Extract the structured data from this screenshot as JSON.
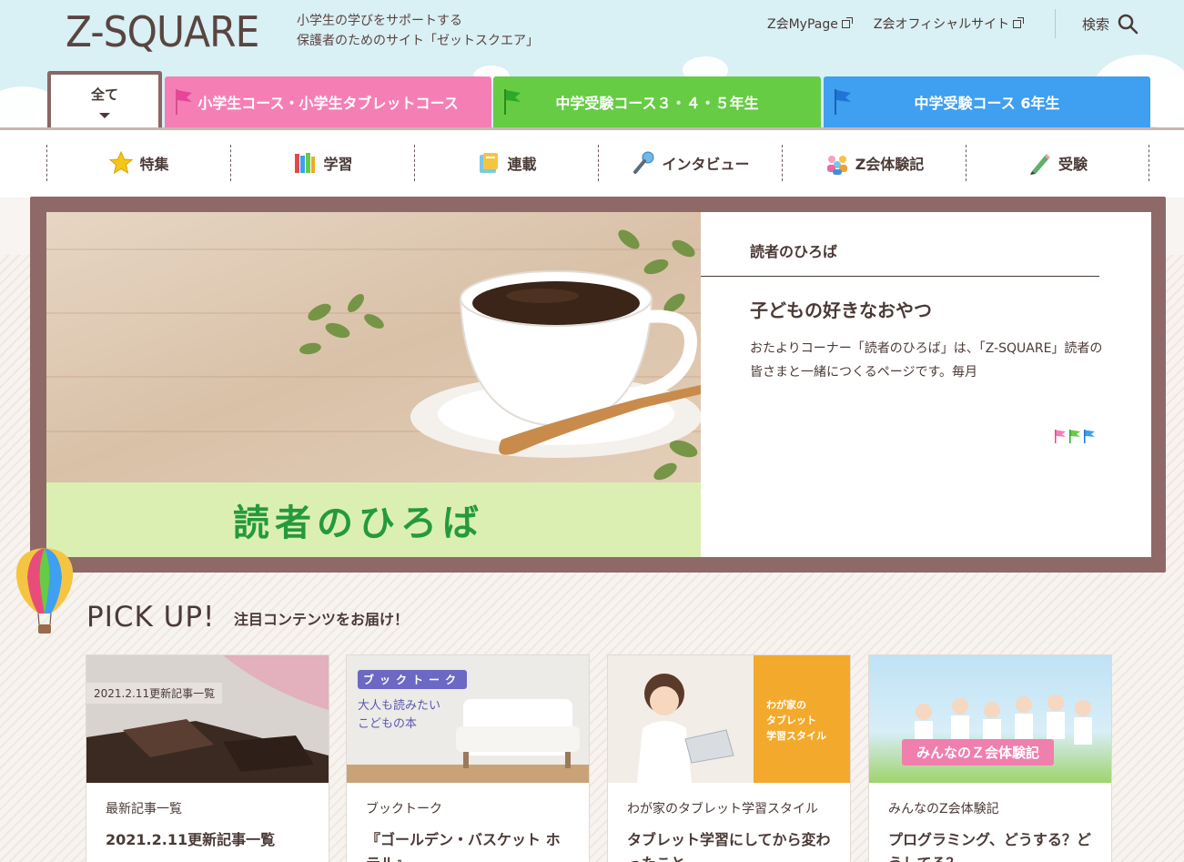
{
  "header": {
    "logo": "Z-SQUARE",
    "tagline_line1": "小学生の学びをサポートする",
    "tagline_line2": "保護者のためのサイト「ゼットスクエア」",
    "links": [
      {
        "label": "Z会MyPage"
      },
      {
        "label": "Z会オフィシャルサイト"
      }
    ],
    "search_label": "検索"
  },
  "tabs": {
    "all": "全て",
    "elementary": "小学生コース・小学生タブレットコース",
    "exam345": "中学受験コース３・４・５年生",
    "exam6": "中学受験コース 6年生",
    "colors": {
      "pink": "#f57fb5",
      "green": "#66cc44",
      "blue": "#3f9ff0"
    }
  },
  "categories": [
    {
      "label": "特集",
      "icon": "star-icon"
    },
    {
      "label": "学習",
      "icon": "books-icon"
    },
    {
      "label": "連載",
      "icon": "notebook-icon"
    },
    {
      "label": "インタビュー",
      "icon": "microphone-icon"
    },
    {
      "label": "Z会体験記",
      "icon": "people-icon"
    },
    {
      "label": "受験",
      "icon": "pencil-icon"
    }
  ],
  "hero": {
    "image_caption": "読者のひろば",
    "category": "読者のひろば",
    "title": "子どもの好きなおやつ",
    "description": "おたよりコーナー「読者のひろば」は、「Z-SQUARE」読者の皆さまと一緒につくるページです。毎月"
  },
  "pickup": {
    "title": "PICK UP!",
    "subtitle": "注目コンテンツをお届け！",
    "cards": [
      {
        "image_label": "2021.2.11更新記事一覧",
        "category": "最新記事一覧",
        "title": "2021.2.11更新記事一覧"
      },
      {
        "image_label_1": "ブックトーク",
        "image_label_2": "大人も読みたい",
        "image_label_3": "こどもの本",
        "category": "ブックトーク",
        "title": "『ゴールデン・バスケット ホテル』"
      },
      {
        "image_label_1": "わが家の",
        "image_label_2": "タブレット",
        "image_label_3": "学習スタイル",
        "category": "わが家のタブレット学習スタイル",
        "title": "タブレット学習にしてから変わったこと"
      },
      {
        "image_label": "みんなのＺ会体験記",
        "category": "みんなのZ会体験記",
        "title": "プログラミング、どうする？どうしてる？"
      }
    ]
  }
}
